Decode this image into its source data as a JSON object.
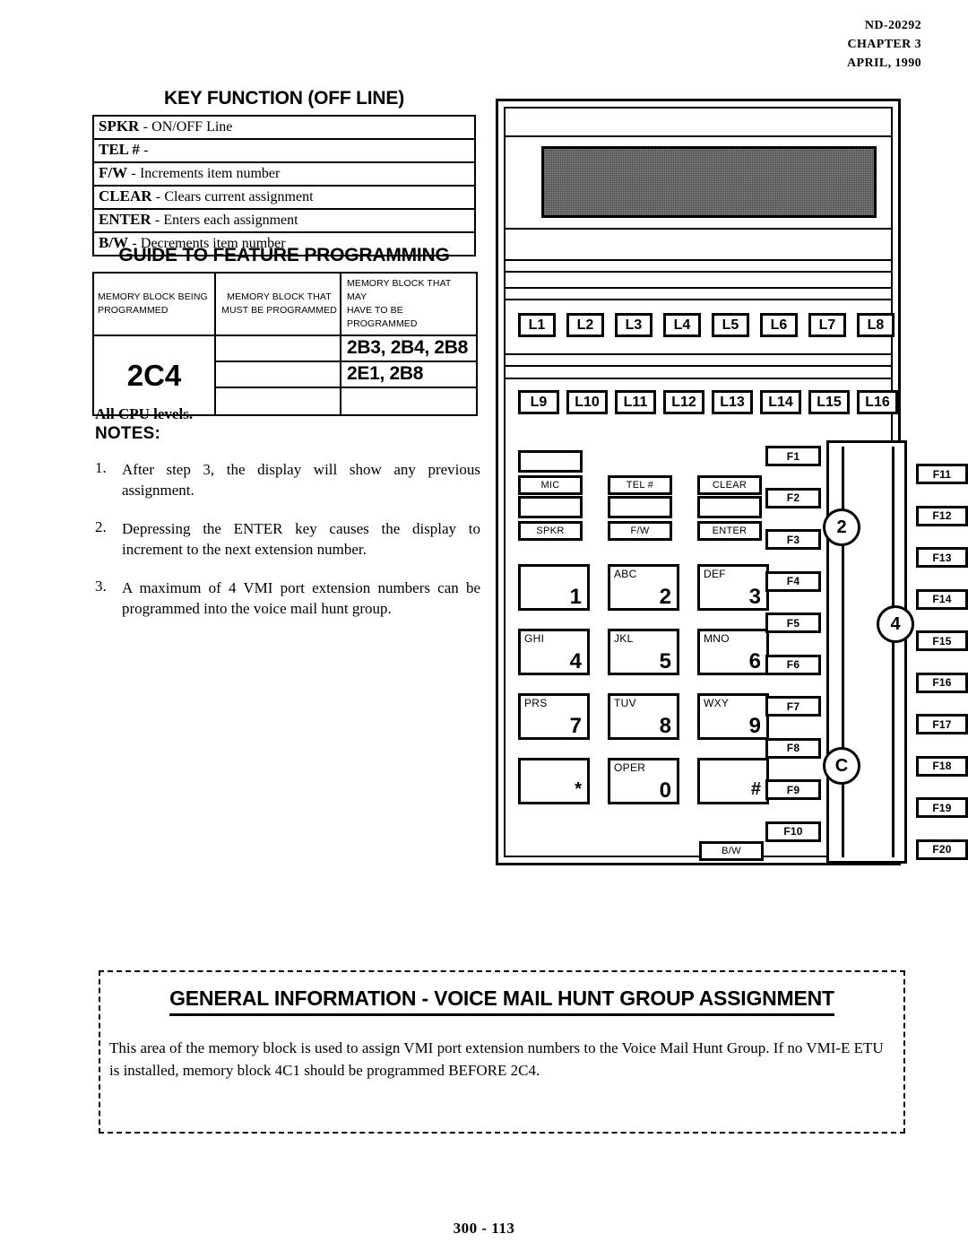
{
  "header": {
    "doc_number": "ND-20292",
    "chapter": "CHAPTER 3",
    "date": "APRIL, 1990"
  },
  "key_function": {
    "title": "KEY FUNCTION (OFF LINE)",
    "rows": [
      {
        "key": "SPKR",
        "dash": "-",
        "desc": "ON/OFF Line"
      },
      {
        "key": "TEL #",
        "dash": "-",
        "desc": ""
      },
      {
        "key": "F/W",
        "dash": "-",
        "desc": "Increments item number"
      },
      {
        "key": "CLEAR",
        "dash": "-",
        "desc": "Clears current  assignment"
      },
      {
        "key": "ENTER",
        "dash": "-",
        "desc": "Enters each assignment"
      },
      {
        "key": "B/W",
        "dash": "-",
        "desc": "Decrements item number"
      }
    ]
  },
  "guide": {
    "title": "GUIDE TO FEATURE PROGRAMMING",
    "headers": [
      "MEMORY BLOCK BEING PROGRAMMED",
      "MEMORY BLOCK THAT MUST BE PROGRAMMED",
      "MEMORY BLOCK THAT MAY HAVE TO BE PROGRAMMED"
    ],
    "header_lines": [
      [
        "MEMORY BLOCK BEING",
        "PROGRAMMED"
      ],
      [
        "MEMORY BLOCK THAT",
        "MUST BE PROGRAMMED"
      ],
      [
        "MEMORY BLOCK THAT MAY",
        "HAVE TO BE PROGRAMMED"
      ]
    ],
    "block_being_programmed": "2C4",
    "rows": [
      {
        "must": "",
        "may": "2B3, 2B4, 2B8"
      },
      {
        "must": "",
        "may": "2E1, 2B8"
      },
      {
        "must": "",
        "may": ""
      }
    ]
  },
  "notes": {
    "cpu_levels": "All CPU levels.",
    "label": "NOTES:",
    "items": [
      {
        "num": "1.",
        "text": "After step 3, the display will show any previous assignment."
      },
      {
        "num": "2.",
        "text": "Depressing the ENTER key causes the display to increment to the next extension number."
      },
      {
        "num": "3.",
        "text": "A maximum of 4 VMI  port extension numbers can be programmed into the voice mail hunt group."
      }
    ]
  },
  "phone": {
    "display_name": "lcd-display",
    "line_keys_row1": [
      "L1",
      "L2",
      "L3",
      "L4",
      "L5",
      "L6",
      "L7",
      "L8"
    ],
    "line_keys_row2": [
      "L9",
      "L10",
      "L11",
      "L12",
      "L13",
      "L14",
      "L15",
      "L16"
    ],
    "function_labels_row1": [
      "MIC",
      "TEL #",
      "CLEAR"
    ],
    "function_labels_row2": [
      "SPKR",
      "F/W",
      "ENTER"
    ],
    "bw_label": "B/W",
    "keypad": [
      {
        "letters": "",
        "digit": "1"
      },
      {
        "letters": "ABC",
        "digit": "2"
      },
      {
        "letters": "DEF",
        "digit": "3"
      },
      {
        "letters": "GHI",
        "digit": "4"
      },
      {
        "letters": "JKL",
        "digit": "5"
      },
      {
        "letters": "MNO",
        "digit": "6"
      },
      {
        "letters": "PRS",
        "digit": "7"
      },
      {
        "letters": "TUV",
        "digit": "8"
      },
      {
        "letters": "WXY",
        "digit": "9"
      },
      {
        "letters": "",
        "digit": "*"
      },
      {
        "letters": "OPER",
        "digit": "0"
      },
      {
        "letters": "",
        "digit": "#"
      }
    ],
    "f_keys_left": [
      "F1",
      "F2",
      "F3",
      "F4",
      "F5",
      "F6",
      "F7",
      "F8",
      "F9",
      "F10"
    ],
    "f_keys_right": [
      "F11",
      "F12",
      "F13",
      "F14",
      "F15",
      "F16",
      "F17",
      "F18",
      "F19",
      "F20"
    ],
    "callouts": [
      {
        "label": "2"
      },
      {
        "label": "4"
      },
      {
        "label": "C"
      }
    ]
  },
  "general_info": {
    "title": "GENERAL INFORMATION - VOICE MAIL HUNT GROUP ASSIGNMENT",
    "paragraph": "This area of the memory block is used to assign VMI port extension numbers to the Voice Mail Hunt Group. If no VMI-E ETU is installed, memory block 4C1 should be programmed BEFORE 2C4."
  },
  "footer": {
    "page": "300 - 113"
  }
}
